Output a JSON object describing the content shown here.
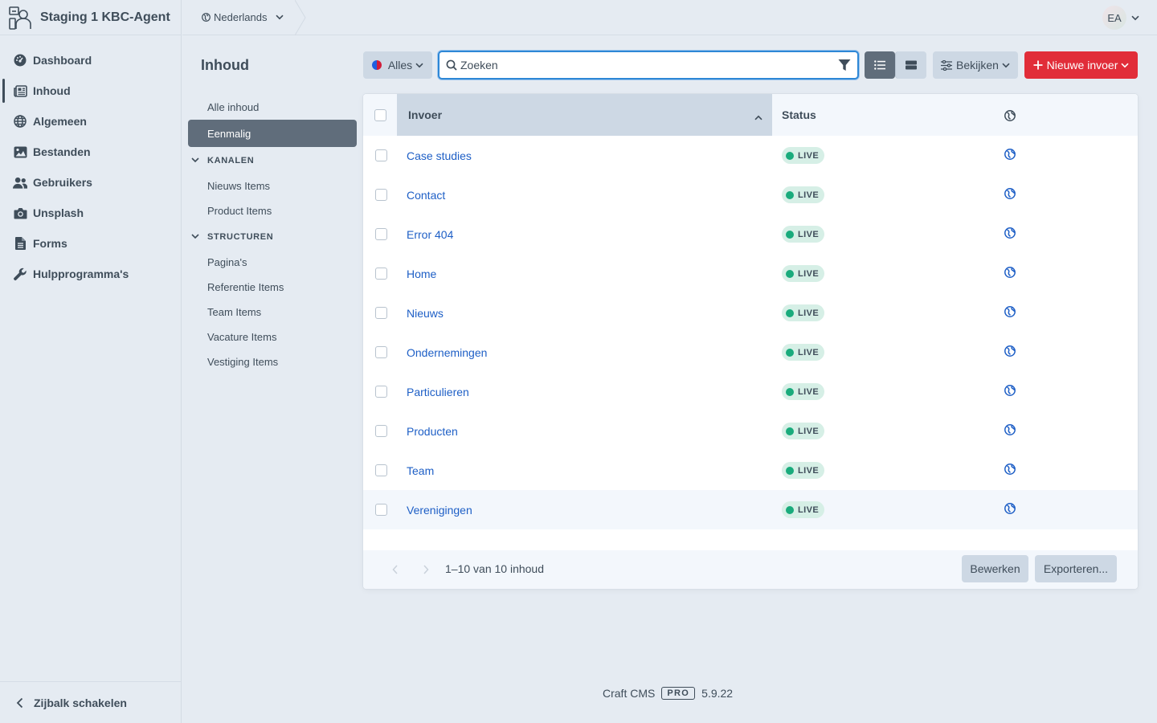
{
  "site": {
    "name": "Staging 1 KBC-Agent"
  },
  "nav": {
    "items": [
      {
        "label": "Dashboard",
        "icon": "gauge-icon"
      },
      {
        "label": "Inhoud",
        "icon": "newspaper-icon",
        "active": true
      },
      {
        "label": "Algemeen",
        "icon": "globe-icon"
      },
      {
        "label": "Bestanden",
        "icon": "image-icon"
      },
      {
        "label": "Gebruikers",
        "icon": "users-icon"
      },
      {
        "label": "Unsplash",
        "icon": "camera-icon"
      },
      {
        "label": "Forms",
        "icon": "file-text-icon"
      },
      {
        "label": "Hulpprogramma's",
        "icon": "wrench-icon"
      }
    ],
    "collapse_label": "Zijbalk schakelen"
  },
  "topbar": {
    "site_switcher": "Nederlands",
    "avatar_initials": "EA"
  },
  "page": {
    "title": "Inhoud"
  },
  "sources": {
    "all": "Alle inhoud",
    "singles": "Eenmalig",
    "kanalen_heading": "KANALEN",
    "kanalen": [
      "Nieuws Items",
      "Product Items"
    ],
    "structuren_heading": "STRUCTUREN",
    "structuren": [
      "Pagina's",
      "Referentie Items",
      "Team Items",
      "Vacature Items",
      "Vestiging Items"
    ]
  },
  "toolbar": {
    "site_filter": "Alles",
    "search_placeholder": "Zoeken",
    "view_label": "Bekijken",
    "new_entry_label": "Nieuwe invoer"
  },
  "table": {
    "columns": {
      "title": "Invoer",
      "status": "Status"
    },
    "rows": [
      {
        "title": "Case studies",
        "status": "LIVE"
      },
      {
        "title": "Contact",
        "status": "LIVE"
      },
      {
        "title": "Error 404",
        "status": "LIVE"
      },
      {
        "title": "Home",
        "status": "LIVE"
      },
      {
        "title": "Nieuws",
        "status": "LIVE"
      },
      {
        "title": "Ondernemingen",
        "status": "LIVE"
      },
      {
        "title": "Particulieren",
        "status": "LIVE"
      },
      {
        "title": "Producten",
        "status": "LIVE"
      },
      {
        "title": "Team",
        "status": "LIVE"
      },
      {
        "title": "Verenigingen",
        "status": "LIVE"
      }
    ],
    "pagination": "1–10 van 10 inhoud",
    "edit_label": "Bewerken",
    "export_label": "Exporteren..."
  },
  "footer": {
    "product": "Craft CMS",
    "edition": "PRO",
    "version": "5.9.22"
  },
  "colors": {
    "accent": "#2e87d6",
    "primary_button": "#e12d39",
    "live": "#1aab7c",
    "link": "#1e5fc6"
  }
}
